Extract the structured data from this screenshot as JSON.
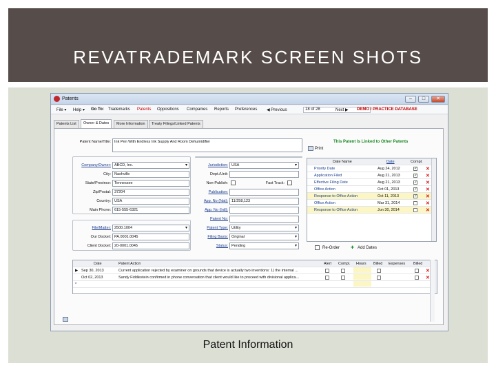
{
  "slide": {
    "title": "REVATRADEMARK SCREEN SHOTS",
    "caption": "Patent Information"
  },
  "window": {
    "title": "Patents",
    "minimize": "–",
    "maximize": "□",
    "close": "✕"
  },
  "menu": {
    "file": "File ▾",
    "help": "Help ▾",
    "goto": "Go To:",
    "trademarks": "Trademarks",
    "patents": "Patents",
    "oppositions": "Oppositions",
    "companies": "Companies",
    "reports": "Reports",
    "preferences": "Preferences",
    "previous": "◀ Previous",
    "record": "18 of 28",
    "next": "Next ▶",
    "database": "DEMO / PRACTICE DATABASE"
  },
  "tabs": [
    "Patents List",
    "Owner & Dates",
    "More Information",
    "Treaty Filings/Linked Patents"
  ],
  "form": {
    "patent_name_label": "Patent Name/Title:",
    "patent_name_value": "Ink Pen With Endless Ink Supply And Room Dehumidifier",
    "print_label": "Print",
    "linked_text": "This Patent Is Linked to Other Patents",
    "company_label": "Company/Owner:",
    "company_value": "ABCD, Inc.",
    "city_label": "City:",
    "city_value": "Nashville",
    "state_label": "State/Province:",
    "state_value": "Tennessee",
    "zip_label": "Zip/Postal:",
    "zip_value": "37204",
    "country_label": "Country:",
    "country_value": "USA",
    "phone_label": "Main Phone:",
    "phone_value": "615-555-6321",
    "file_label": "File/Matter:",
    "file_value": "2500.1004",
    "our_docket_label": "Our Docket:",
    "our_docket_value": "PA.0001.0045",
    "client_docket_label": "Client Docket:",
    "client_docket_value": "20-0001.0045",
    "jurisdiction_label": "Jurisdiction:",
    "jurisdiction_value": "USA",
    "dept_label": "Dept./Unit:",
    "dept_value": "",
    "nonpublish_label": "Non-Publish:",
    "fasttrack_label": "Fast Track:",
    "publication_label": "Publication:",
    "publication_value": "",
    "app_nat_label": "App. No (Nat):",
    "app_nat_value": "11/258,123",
    "app_intl_label": "App. No (Intl):",
    "app_intl_value": "",
    "patent_no_label": "Patent No:",
    "patent_no_value": "",
    "patent_type_label": "Patent Type:",
    "patent_type_value": "Utility",
    "filing_basis_label": "Filing Basis:",
    "filing_basis_value": "Original",
    "status_label": "Status:",
    "status_value": "Pending"
  },
  "dates_grid": {
    "headers": [
      "Date Name",
      "Date",
      "Compl."
    ],
    "rows": [
      {
        "name": "Priority Date",
        "date": "Aug 24, 2012",
        "compl": "✓"
      },
      {
        "name": "Application Filed",
        "date": "Aug 21, 2013",
        "compl": "✓"
      },
      {
        "name": "Effective Filing Date",
        "date": "Aug 21, 2013",
        "compl": "✓"
      },
      {
        "name": "Office Action",
        "date": "Oct 01, 2013",
        "compl": "✓"
      },
      {
        "name": "Response to Office Action",
        "date": "Oct 11, 2013",
        "compl": "✓"
      },
      {
        "name": "Office Action",
        "date": "Mar 31, 2014",
        "compl": ""
      },
      {
        "name": "Response to Office Action",
        "date": "Jun 30, 2014",
        "compl": ""
      }
    ],
    "reorder": "Re-Order",
    "add_dates": "Add Dates"
  },
  "actions_grid": {
    "headers": [
      "Date",
      "Patent Action",
      "Alert",
      "Compl.",
      "Hours",
      "Billed",
      "Expenses",
      "Billed"
    ],
    "rows": [
      {
        "date": "Sep 30, 2013",
        "action": "Current application rejected by examiner on grounds that device is actually two inventions: 1) the internal ..."
      },
      {
        "date": "Oct 02, 2013",
        "action": "Sandy Fiddlestein confirmed in phone conversation that client would like to proceed with divisional applica..."
      }
    ]
  },
  "colors": {
    "header_bg": "#564c49",
    "body_bg": "#dcdfd3",
    "link_green": "#1c8a27",
    "accent_red": "#c00000"
  }
}
